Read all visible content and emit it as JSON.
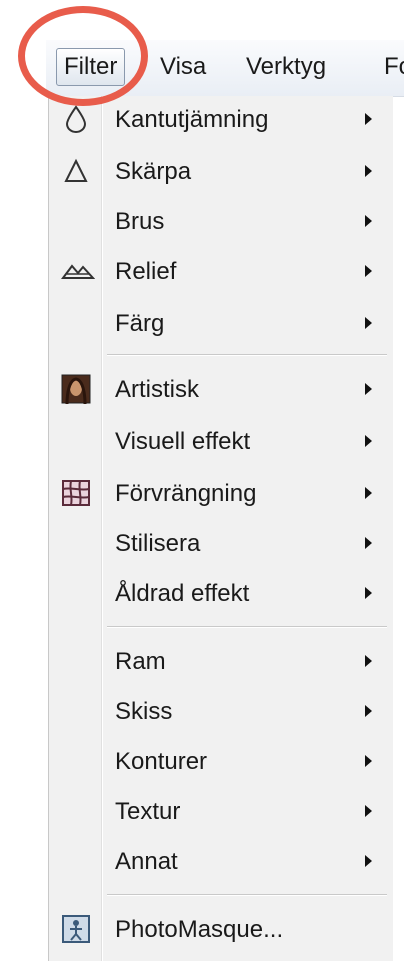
{
  "menubar": {
    "items": [
      {
        "label": "Filter"
      },
      {
        "label": "Visa"
      },
      {
        "label": "Verktyg"
      },
      {
        "label": "Fo"
      }
    ]
  },
  "filter_menu": {
    "items": [
      {
        "label": "Kantutjämning",
        "icon": "drop-icon",
        "submenu": true
      },
      {
        "label": "Skärpa",
        "icon": "triangle-icon",
        "submenu": true
      },
      {
        "label": "Brus",
        "submenu": true
      },
      {
        "label": "Relief",
        "icon": "relief-mountain-icon",
        "submenu": true
      },
      {
        "label": "Färg",
        "submenu": true
      },
      {
        "label": "Artistisk",
        "icon": "portrait-icon",
        "submenu": true
      },
      {
        "label": "Visuell effekt",
        "submenu": true
      },
      {
        "label": "Förvrängning",
        "icon": "grid-distort-icon",
        "submenu": true
      },
      {
        "label": "Stilisera",
        "submenu": true
      },
      {
        "label": "Åldrad effekt",
        "submenu": true
      },
      {
        "label": "Ram",
        "submenu": true
      },
      {
        "label": "Skiss",
        "submenu": true
      },
      {
        "label": "Konturer",
        "submenu": true
      },
      {
        "label": "Textur",
        "submenu": true
      },
      {
        "label": "Annat",
        "submenu": true
      },
      {
        "label": "PhotoMasque...",
        "icon": "photomasque-icon",
        "submenu": false
      }
    ]
  },
  "colors": {
    "highlight_ring": "#e85c4b",
    "menu_background": "#f1f1f1"
  }
}
